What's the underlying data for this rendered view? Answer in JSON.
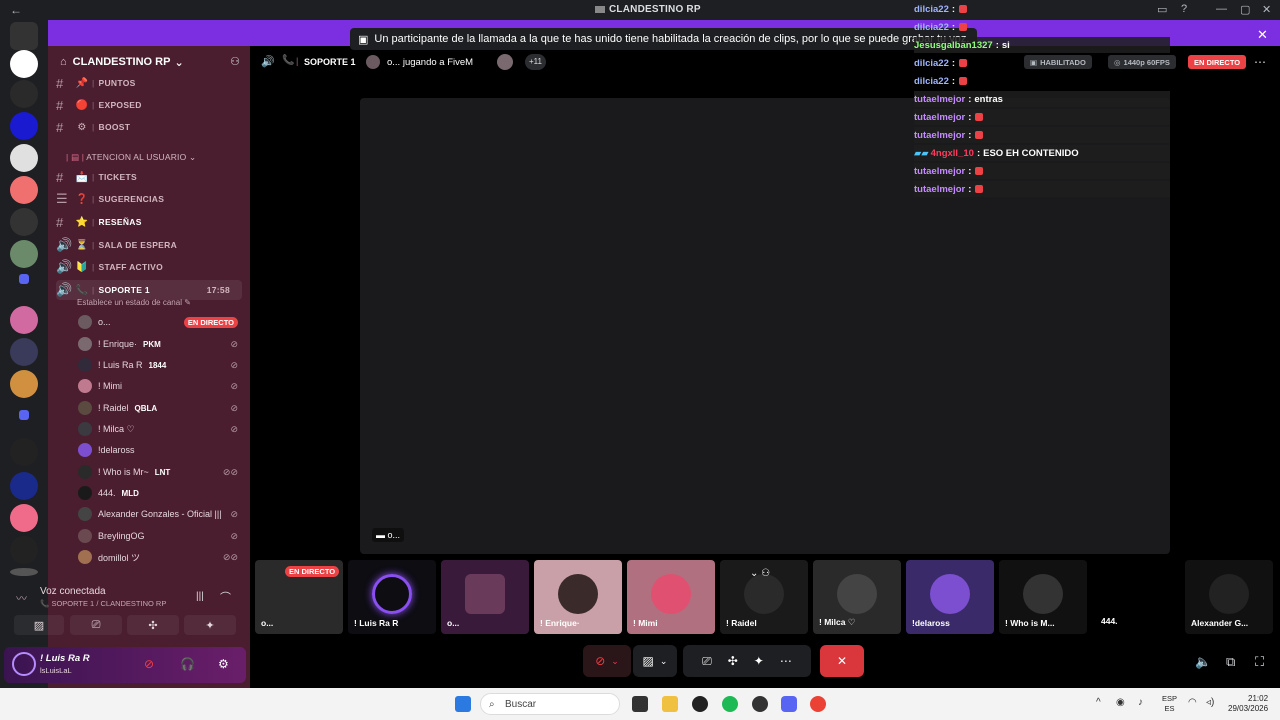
{
  "window": {
    "title": "CLANDESTINO RP",
    "back_icon": "←"
  },
  "notice": {
    "text": "Un participante de la llamada a la que te has unido tiene habilitada la creación de clips, por lo que se puede grabar tu voz."
  },
  "server": {
    "name": "CLANDESTINO RP",
    "channels_top": [
      {
        "label": "PUNTOS",
        "emoji": "📌"
      },
      {
        "label": "EXPOSED",
        "emoji": "🔴"
      },
      {
        "label": "BOOST",
        "emoji": "⚙"
      }
    ],
    "category": "ATENCION AL USUARIO",
    "channels_cat": [
      {
        "label": "TICKETS",
        "emoji": "📩"
      },
      {
        "label": "SUGERENCIAS",
        "emoji": "❓"
      },
      {
        "label": "RESEÑAS",
        "emoji": "⭐"
      },
      {
        "label": "SALA DE ESPERA",
        "emoji": "⏳"
      },
      {
        "label": "STAFF ACTIVO",
        "emoji": "🔰"
      }
    ],
    "active_voice": {
      "label": "SOPORTE 1",
      "time": "17:58",
      "hint": "Establece un estado de canal"
    }
  },
  "voice_users": [
    {
      "name": "o...",
      "tag": "",
      "live": "EN DIRECTO",
      "color": "#6b5a60"
    },
    {
      "name": "! Enrique·",
      "tag": "PKM",
      "live": "",
      "color": "#7a6a70"
    },
    {
      "name": "! Luis Ra R",
      "tag": "1844",
      "live": "",
      "color": "#302a3a"
    },
    {
      "name": "! Mimi",
      "tag": "",
      "live": "",
      "color": "#c07a90"
    },
    {
      "name": "! Raidel",
      "tag": "QBLA",
      "live": "",
      "color": "#5a4a40"
    },
    {
      "name": "! Milca ♡",
      "tag": "",
      "live": "",
      "color": "#3a3a40"
    },
    {
      "name": "!delaross",
      "tag": "",
      "live": "",
      "color": "#7b4fd0"
    },
    {
      "name": "! Who is Mr~",
      "tag": "LNT",
      "live": "",
      "color": "#2a2a2a"
    },
    {
      "name": "444.",
      "tag": "MLD",
      "live": "",
      "color": "#1a1a1a"
    },
    {
      "name": "Alexander Gonzales - Oficial |||",
      "tag": "",
      "live": "",
      "color": "#444"
    },
    {
      "name": "BreylingOG",
      "tag": "",
      "live": "",
      "color": "#6a4a50"
    },
    {
      "name": "domillol ツ",
      "tag": "",
      "live": "",
      "color": "#a07050"
    }
  ],
  "voice_panel": {
    "status": "Voz conectada",
    "channel": "SOPORTE 1 / CLANDESTINO RP"
  },
  "user": {
    "name": "! Luis Ra R",
    "status": "lsLuisLaL"
  },
  "stage": {
    "channel": "SOPORTE 1",
    "activity": "o... jugando a FiveM",
    "extra": "+11",
    "habilitado": "HABILITADO",
    "quality": "1440p 60FPS",
    "live": "EN DIRECTO",
    "stream_label": "o..."
  },
  "chat": [
    {
      "user": "dilcia22",
      "text": "",
      "emote": true,
      "style": ""
    },
    {
      "user": "dilcia22",
      "text": "",
      "emote": true,
      "style": ""
    },
    {
      "user": "Jesusgalban1327",
      "text": "si",
      "emote": false,
      "style": "green"
    },
    {
      "user": "dilcia22",
      "text": "",
      "emote": true,
      "style": ""
    },
    {
      "user": "dilcia22",
      "text": "",
      "emote": true,
      "style": ""
    },
    {
      "user": "tutaelmejor",
      "text": "entras",
      "emote": false,
      "style": "purple"
    },
    {
      "user": "tutaelmejor",
      "text": "",
      "emote": true,
      "style": "purple"
    },
    {
      "user": "tutaelmejor",
      "text": "",
      "emote": true,
      "style": "purple"
    },
    {
      "user": "4ngxll_10",
      "text": "ESO EH CONTENIDO",
      "emote": false,
      "style": "red"
    },
    {
      "user": "tutaelmejor",
      "text": "",
      "emote": true,
      "style": "purple"
    },
    {
      "user": "tutaelmejor",
      "text": "",
      "emote": true,
      "style": "purple"
    }
  ],
  "tiles": [
    {
      "name": "o...",
      "live": "EN DIRECTO",
      "color": "#2a2a2a"
    },
    {
      "name": "! Luis Ra R",
      "live": "",
      "color": "#0d0d12"
    },
    {
      "name": "o...",
      "live": "",
      "color": "#3a1a3a"
    },
    {
      "name": "! Enrique·",
      "live": "",
      "color": "#c9a0a8"
    },
    {
      "name": "! Mimi",
      "live": "",
      "color": "#b07080"
    },
    {
      "name": "! Raidel",
      "live": "",
      "color": "#1a1a1a"
    },
    {
      "name": "! Milca ♡",
      "live": "",
      "color": "#2a2a2a"
    },
    {
      "name": "!delaross",
      "live": "",
      "color": "#3a2a6a"
    },
    {
      "name": "! Who is M...",
      "live": "",
      "color": "#111"
    },
    {
      "name": "444.",
      "live": "",
      "color": "#000"
    },
    {
      "name": "Alexander G...",
      "live": "",
      "color": "#111"
    }
  ],
  "taskbar": {
    "search": "Buscar",
    "lang": "ESP",
    "lang_sub": "ES",
    "time": "21:02",
    "date": "29/03/2026"
  }
}
